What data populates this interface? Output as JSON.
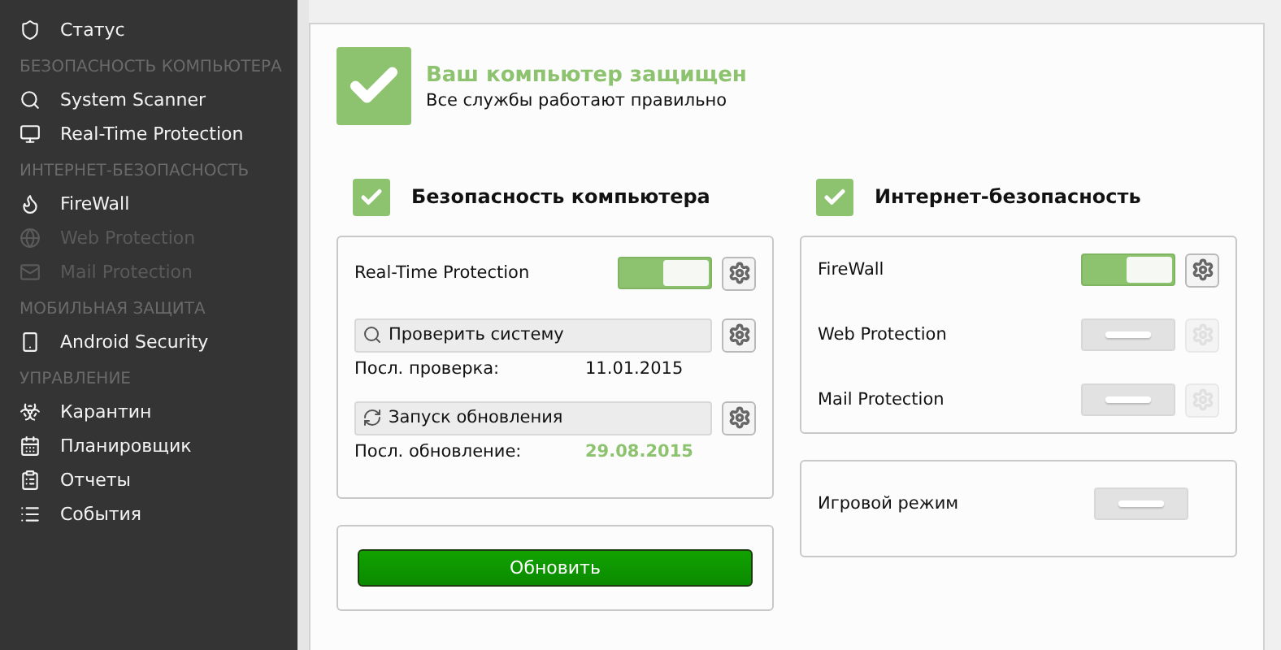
{
  "sidebar": {
    "items": [
      {
        "kind": "item",
        "label": "Статус",
        "disabled": false
      },
      {
        "kind": "header",
        "label": "БЕЗОПАСНОСТЬ КОМПЬЮТЕРА"
      },
      {
        "kind": "item",
        "label": "System Scanner",
        "disabled": false
      },
      {
        "kind": "item",
        "label": "Real-Time Protection",
        "disabled": false
      },
      {
        "kind": "header",
        "label": "ИНТЕРНЕТ-БЕЗОПАСНОСТЬ"
      },
      {
        "kind": "item",
        "label": "FireWall",
        "disabled": false
      },
      {
        "kind": "item",
        "label": "Web Protection",
        "disabled": true
      },
      {
        "kind": "item",
        "label": "Mail Protection",
        "disabled": true
      },
      {
        "kind": "header",
        "label": "МОБИЛЬНАЯ ЗАЩИТА"
      },
      {
        "kind": "item",
        "label": "Android Security",
        "disabled": false
      },
      {
        "kind": "header",
        "label": "УПРАВЛЕНИЕ"
      },
      {
        "kind": "item",
        "label": "Карантин",
        "disabled": false
      },
      {
        "kind": "item",
        "label": "Планировщик",
        "disabled": false
      },
      {
        "kind": "item",
        "label": "Отчеты",
        "disabled": false
      },
      {
        "kind": "item",
        "label": "События",
        "disabled": false
      }
    ]
  },
  "status": {
    "title": "Ваш компьютер защищен",
    "subtitle": "Все службы работают правильно"
  },
  "computer_security": {
    "title": "Безопасность компьютера",
    "rows": [
      {
        "kind": "toggle",
        "label": "Real-Time Protection",
        "on": true,
        "settings_disabled": false
      },
      {
        "kind": "action",
        "button": "Проверить систему",
        "info_label": "Посл. проверка:",
        "info_value": "11.01.2015",
        "highlighted": false
      },
      {
        "kind": "action",
        "button": "Запуск обновления",
        "info_label": "Посл. обновление:",
        "info_value": "29.08.2015",
        "highlighted": true
      }
    ],
    "update_button": "Обновить"
  },
  "internet_security": {
    "title": "Интернет-безопасность",
    "rows": [
      {
        "label": "FireWall",
        "on": true,
        "settings_disabled": false
      },
      {
        "label": "Web Protection",
        "on": false,
        "settings_disabled": true
      },
      {
        "label": "Mail Protection",
        "on": false,
        "settings_disabled": true
      }
    ]
  },
  "game_mode": {
    "label": "Игровой режим",
    "on": false
  }
}
